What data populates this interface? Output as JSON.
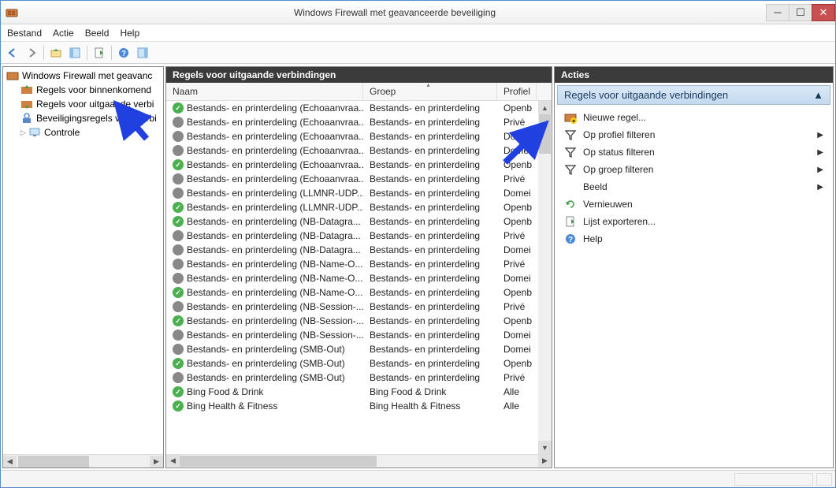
{
  "window": {
    "title": "Windows Firewall met geavanceerde beveiliging"
  },
  "menu": {
    "file": "Bestand",
    "action": "Actie",
    "view": "Beeld",
    "help": "Help"
  },
  "tree": {
    "root": "Windows Firewall met geavanc",
    "inbound": "Regels voor binnenkomend",
    "outbound": "Regels voor uitgaande verbi",
    "security": "Beveiligingsregels voor verbi",
    "monitoring": "Controle"
  },
  "rules_pane": {
    "title": "Regels voor uitgaande verbindingen",
    "columns": {
      "name": "Naam",
      "group": "Groep",
      "profile": "Profiel"
    },
    "rows": [
      {
        "enabled": true,
        "name": "Bestands- en printerdeling (Echoaanvraa...",
        "group": "Bestands- en printerdeling",
        "profile": "Openb"
      },
      {
        "enabled": false,
        "name": "Bestands- en printerdeling (Echoaanvraa...",
        "group": "Bestands- en printerdeling",
        "profile": "Privé"
      },
      {
        "enabled": false,
        "name": "Bestands- en printerdeling (Echoaanvraa...",
        "group": "Bestands- en printerdeling",
        "profile": "Domei"
      },
      {
        "enabled": false,
        "name": "Bestands- en printerdeling (Echoaanvraa...",
        "group": "Bestands- en printerdeling",
        "profile": "Domei"
      },
      {
        "enabled": true,
        "name": "Bestands- en printerdeling (Echoaanvraa...",
        "group": "Bestands- en printerdeling",
        "profile": "Openb"
      },
      {
        "enabled": false,
        "name": "Bestands- en printerdeling (Echoaanvraa...",
        "group": "Bestands- en printerdeling",
        "profile": "Privé"
      },
      {
        "enabled": false,
        "name": "Bestands- en printerdeling (LLMNR-UDP...",
        "group": "Bestands- en printerdeling",
        "profile": "Domei"
      },
      {
        "enabled": true,
        "name": "Bestands- en printerdeling (LLMNR-UDP...",
        "group": "Bestands- en printerdeling",
        "profile": "Openb"
      },
      {
        "enabled": true,
        "name": "Bestands- en printerdeling (NB-Datagra...",
        "group": "Bestands- en printerdeling",
        "profile": "Openb"
      },
      {
        "enabled": false,
        "name": "Bestands- en printerdeling (NB-Datagra...",
        "group": "Bestands- en printerdeling",
        "profile": "Privé"
      },
      {
        "enabled": false,
        "name": "Bestands- en printerdeling (NB-Datagra...",
        "group": "Bestands- en printerdeling",
        "profile": "Domei"
      },
      {
        "enabled": false,
        "name": "Bestands- en printerdeling (NB-Name-O...",
        "group": "Bestands- en printerdeling",
        "profile": "Privé"
      },
      {
        "enabled": false,
        "name": "Bestands- en printerdeling (NB-Name-O...",
        "group": "Bestands- en printerdeling",
        "profile": "Domei"
      },
      {
        "enabled": true,
        "name": "Bestands- en printerdeling (NB-Name-O...",
        "group": "Bestands- en printerdeling",
        "profile": "Openb"
      },
      {
        "enabled": false,
        "name": "Bestands- en printerdeling (NB-Session-...",
        "group": "Bestands- en printerdeling",
        "profile": "Privé"
      },
      {
        "enabled": true,
        "name": "Bestands- en printerdeling (NB-Session-...",
        "group": "Bestands- en printerdeling",
        "profile": "Openb"
      },
      {
        "enabled": false,
        "name": "Bestands- en printerdeling (NB-Session-...",
        "group": "Bestands- en printerdeling",
        "profile": "Domei"
      },
      {
        "enabled": false,
        "name": "Bestands- en printerdeling (SMB-Out)",
        "group": "Bestands- en printerdeling",
        "profile": "Domei"
      },
      {
        "enabled": true,
        "name": "Bestands- en printerdeling (SMB-Out)",
        "group": "Bestands- en printerdeling",
        "profile": "Openb"
      },
      {
        "enabled": false,
        "name": "Bestands- en printerdeling (SMB-Out)",
        "group": "Bestands- en printerdeling",
        "profile": "Privé"
      },
      {
        "enabled": true,
        "name": "Bing Food & Drink",
        "group": "Bing Food & Drink",
        "profile": "Alle"
      },
      {
        "enabled": true,
        "name": "Bing Health & Fitness",
        "group": "Bing Health & Fitness",
        "profile": "Alle"
      }
    ]
  },
  "actions_pane": {
    "title": "Acties",
    "subtitle": "Regels voor uitgaande verbindingen",
    "items": [
      {
        "icon": "new-rule",
        "label": "Nieuwe regel...",
        "arrow": false
      },
      {
        "icon": "filter",
        "label": "Op profiel filteren",
        "arrow": true
      },
      {
        "icon": "filter",
        "label": "Op status filteren",
        "arrow": true
      },
      {
        "icon": "filter",
        "label": "Op groep filteren",
        "arrow": true
      },
      {
        "icon": "none",
        "label": "Beeld",
        "arrow": true
      },
      {
        "icon": "refresh",
        "label": "Vernieuwen",
        "arrow": false
      },
      {
        "icon": "export",
        "label": "Lijst exporteren...",
        "arrow": false
      },
      {
        "icon": "help",
        "label": "Help",
        "arrow": false
      }
    ]
  }
}
